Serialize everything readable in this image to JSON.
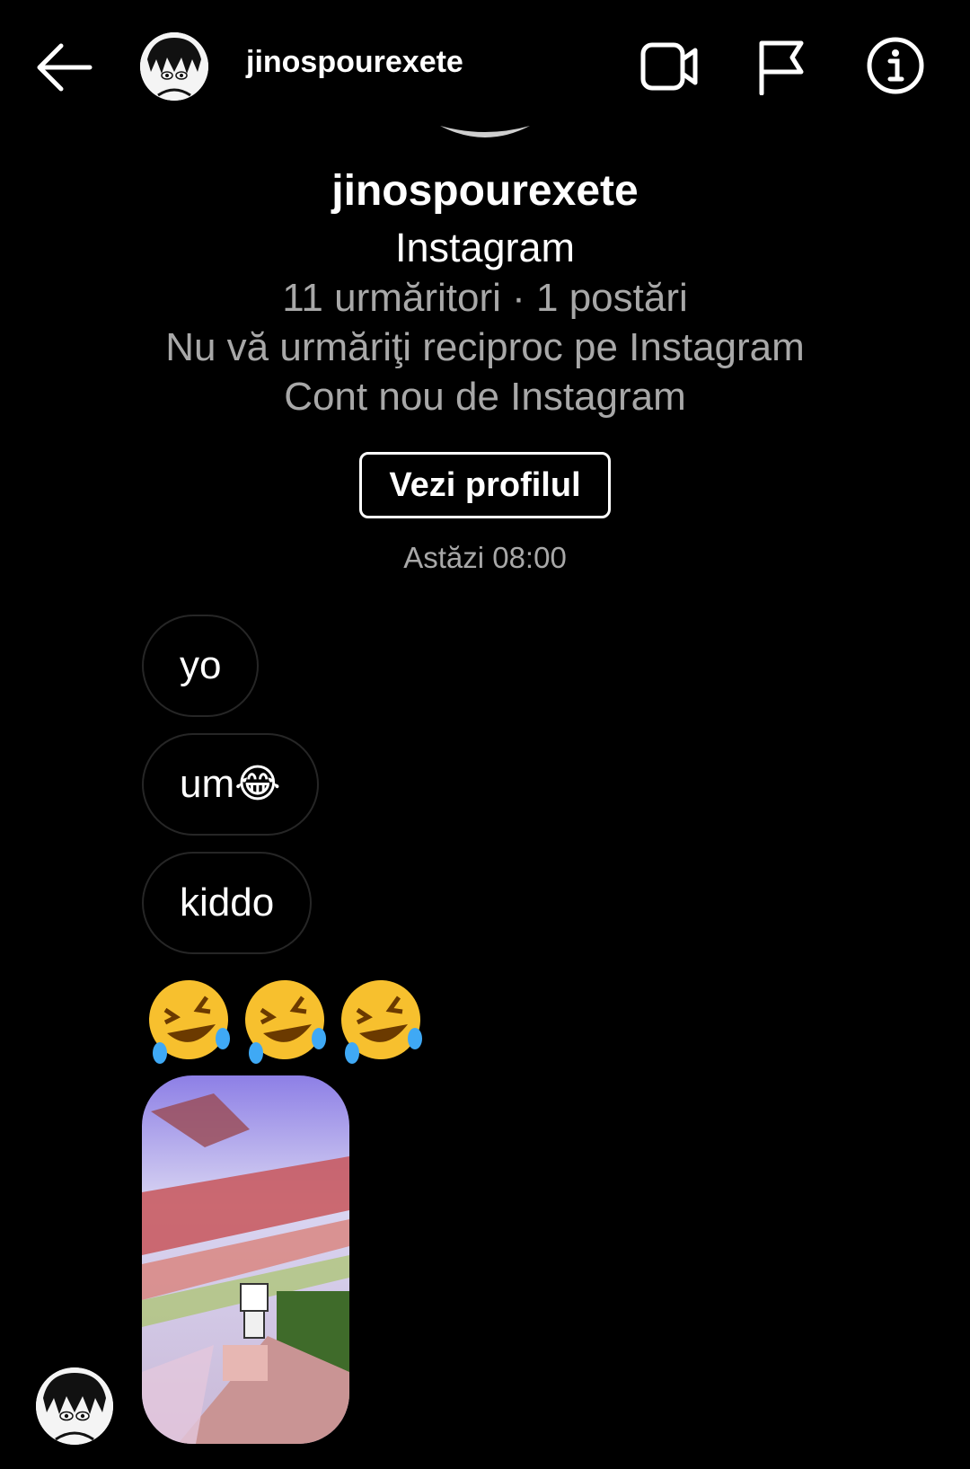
{
  "header": {
    "username": "jinospourexete",
    "icons": [
      "back-arrow-icon",
      "avatar",
      "video-call-icon",
      "flag-icon",
      "info-icon"
    ]
  },
  "profile": {
    "name": "jinospourexete",
    "platform": "Instagram",
    "stats": "11 urmăritori · 1 postări",
    "follow_status": "Nu vă urmăriţi reciproc pe Instagram",
    "account_note": "Cont nou de Instagram",
    "view_profile_label": "Vezi profilul"
  },
  "timestamp": "Astăzi 08:00",
  "messages": [
    {
      "text": "yo"
    },
    {
      "text": "um😂"
    },
    {
      "text": "kiddo"
    },
    {
      "text": "🤣🤣🤣"
    }
  ],
  "colors": {
    "background": "#000000",
    "text": "#ffffff",
    "secondary_text": "#a8a8a8",
    "bubble_border": "#262626"
  }
}
